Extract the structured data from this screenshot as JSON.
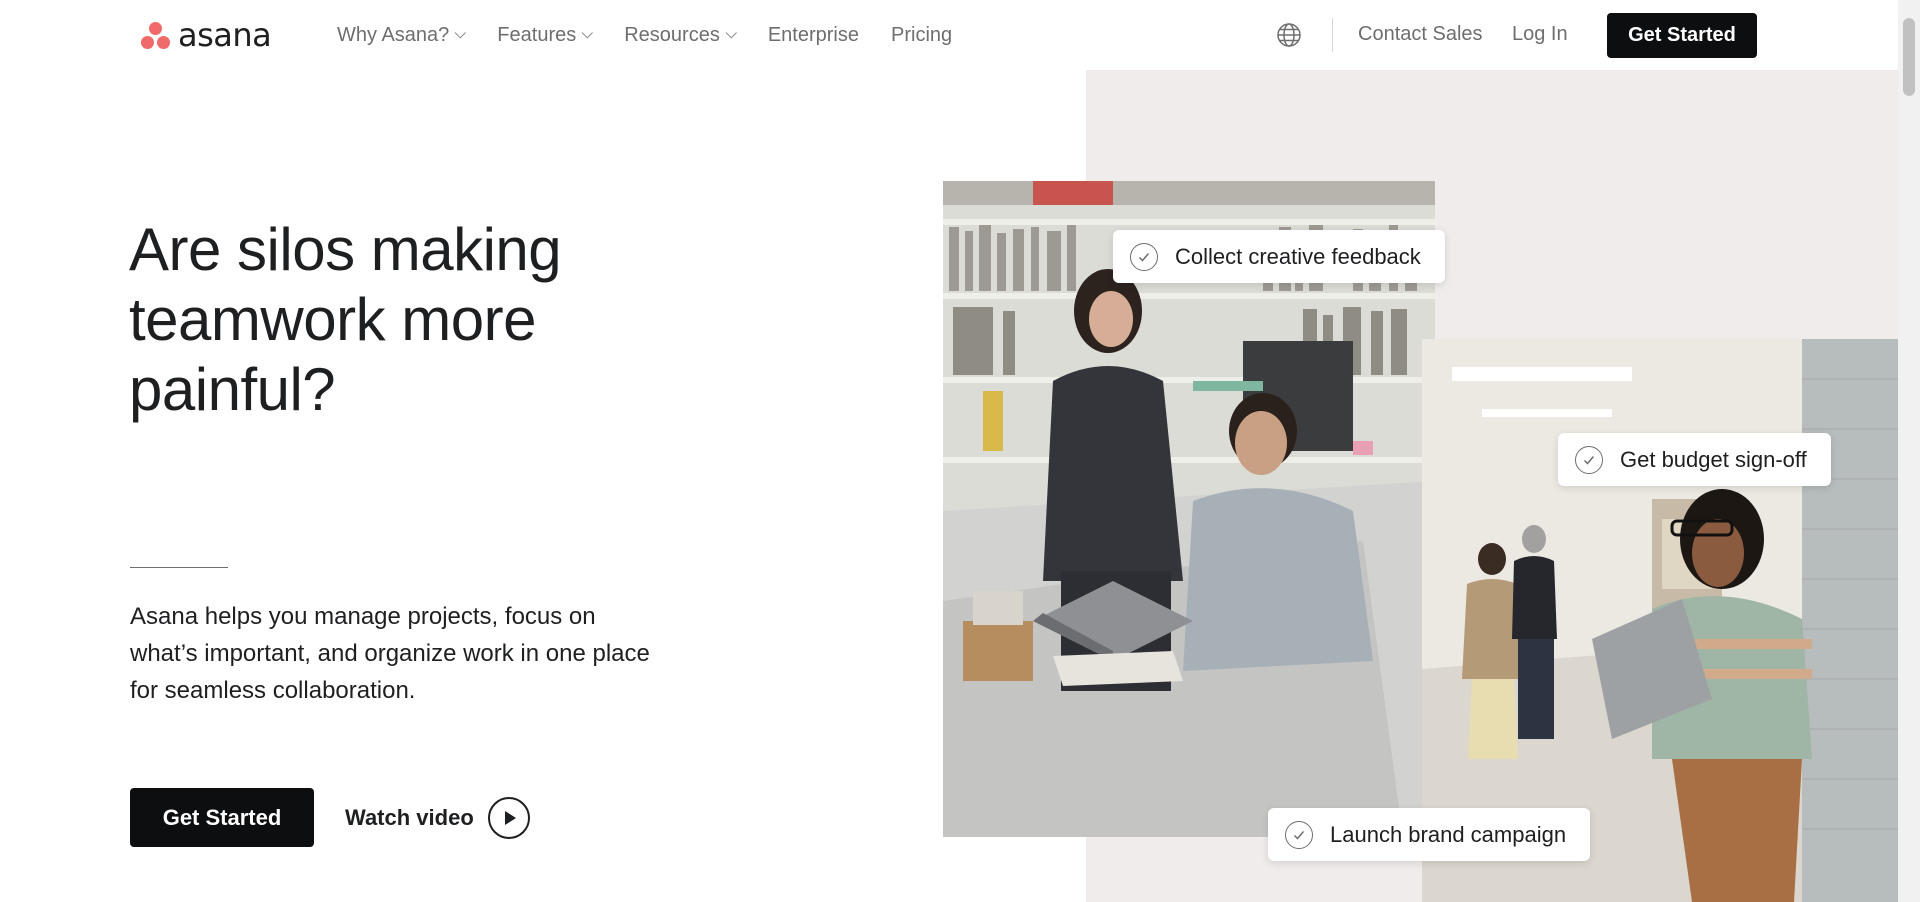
{
  "brand": {
    "name": "asana",
    "dot_color": "#f06a6a"
  },
  "nav": {
    "links": [
      {
        "label": "Why Asana?",
        "has_dropdown": true
      },
      {
        "label": "Features",
        "has_dropdown": true
      },
      {
        "label": "Resources",
        "has_dropdown": true
      },
      {
        "label": "Enterprise",
        "has_dropdown": false
      },
      {
        "label": "Pricing",
        "has_dropdown": false
      }
    ],
    "language_icon": "globe-icon",
    "contact_sales": "Contact Sales",
    "log_in": "Log In",
    "cta": "Get Started"
  },
  "hero": {
    "headline_lines": [
      "Are silos making",
      "teamwork more",
      "painful?"
    ],
    "subtext": "Asana helps you manage projects, focus on what’s important, and organize work in one place for seamless collaboration.",
    "cta": "Get Started",
    "watch_video": "Watch video",
    "cards": [
      {
        "label": "Collect creative feedback",
        "icon": "check-circle-icon"
      },
      {
        "label": "Get budget sign-off",
        "icon": "check-circle-icon"
      },
      {
        "label": "Launch brand campaign",
        "icon": "check-circle-icon"
      }
    ]
  },
  "colors": {
    "primary_button": "#0d0e10",
    "text": "#1e1f21",
    "muted_text": "#6d6e6f",
    "panel_bg": "#efeceb"
  }
}
